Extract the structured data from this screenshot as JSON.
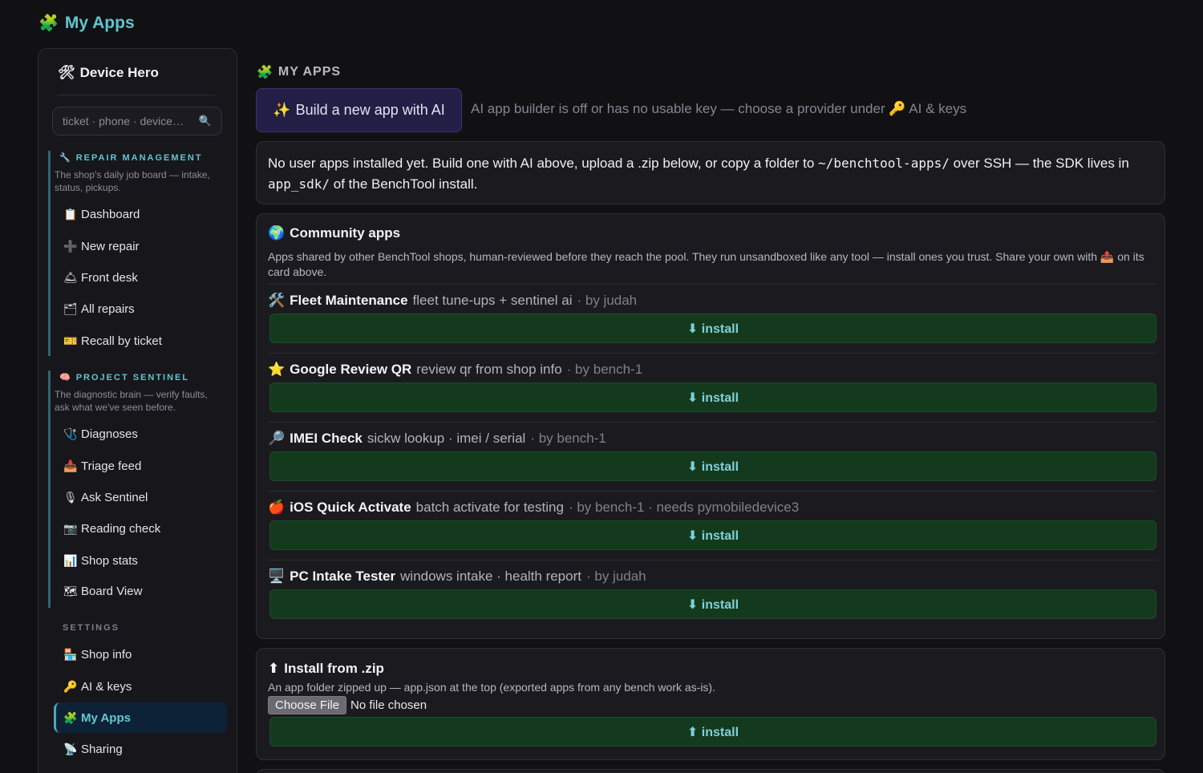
{
  "header": {
    "icon": "🧩",
    "title": "My Apps"
  },
  "sidebar": {
    "brand": {
      "icon": "🛠",
      "title": "Device Hero"
    },
    "search": {
      "placeholder": "ticket · phone · device…",
      "icon": "🔍"
    },
    "groups": [
      {
        "icon": "🔧",
        "title": "REPAIR MANAGEMENT",
        "desc": "The shop's daily job board — intake, status, pickups.",
        "items": [
          {
            "icon": "📋",
            "label": "Dashboard"
          },
          {
            "icon": "➕",
            "label": "New repair"
          },
          {
            "icon": "🛎",
            "label": "Front desk"
          },
          {
            "icon": "🗂",
            "label": "All repairs"
          },
          {
            "icon": "🎫",
            "label": "Recall by ticket"
          }
        ]
      },
      {
        "icon": "🧠",
        "title": "PROJECT SENTINEL",
        "desc": "The diagnostic brain — verify faults, ask what we've seen before.",
        "items": [
          {
            "icon": "🩺",
            "label": "Diagnoses"
          },
          {
            "icon": "📥",
            "label": "Triage feed"
          },
          {
            "icon": "🎙",
            "label": "Ask Sentinel"
          },
          {
            "icon": "📷",
            "label": "Reading check"
          },
          {
            "icon": "📊",
            "label": "Shop stats"
          },
          {
            "icon": "🗺",
            "label": "Board View"
          }
        ]
      }
    ],
    "settings": {
      "title": "SETTINGS",
      "items": [
        {
          "icon": "🏪",
          "label": "Shop info"
        },
        {
          "icon": "🔑",
          "label": "AI & keys"
        },
        {
          "icon": "🧩",
          "label": "My Apps",
          "active": true
        },
        {
          "icon": "📡",
          "label": "Sharing"
        }
      ]
    }
  },
  "main": {
    "title_icon": "🧩",
    "title": "MY APPS",
    "build_button": {
      "icon": "✨",
      "label": "Build a new app with AI"
    },
    "ai_note": "AI app builder is off or has no usable key — choose a provider under 🔑 AI & keys",
    "empty": {
      "t1": "No user apps installed yet. Build one with AI above, upload a .zip below, or copy a folder to ",
      "code1": "~/benchtool-apps/",
      "t2": " over SSH — the SDK lives in ",
      "code2": "app_sdk/",
      "t3": " of the BenchTool install."
    },
    "community": {
      "icon": "🌍",
      "title": "Community apps",
      "desc": "Apps shared by other BenchTool shops, human-reviewed before they reach the pool. They run unsandboxed like any tool — install ones you trust. Share your own with 📤 on its card above.",
      "install_label": "⬇ install",
      "apps": [
        {
          "icon": "🛠️",
          "name": "Fleet Maintenance",
          "tagline": "fleet tune-ups + sentinel ai",
          "meta": "· by judah"
        },
        {
          "icon": "⭐",
          "name": "Google Review QR",
          "tagline": "review qr from shop info",
          "meta": "· by bench-1"
        },
        {
          "icon": "🔎",
          "name": "IMEI Check",
          "tagline": "sickw lookup · imei / serial",
          "meta": "· by bench-1"
        },
        {
          "icon": "🍎",
          "name": "iOS Quick Activate",
          "tagline": "batch activate for testing",
          "meta": "· by bench-1 · needs pymobiledevice3"
        },
        {
          "icon": "🖥️",
          "name": "PC Intake Tester",
          "tagline": "windows intake · health report",
          "meta": "· by judah"
        }
      ]
    },
    "zip": {
      "icon": "⬆",
      "title": "Install from .zip",
      "desc": "An app folder zipped up — app.json at the top (exported apps from any bench work as-is).",
      "choose_label": "Choose File",
      "file_status": "No file chosen",
      "install_label": "⬆ install"
    }
  }
}
